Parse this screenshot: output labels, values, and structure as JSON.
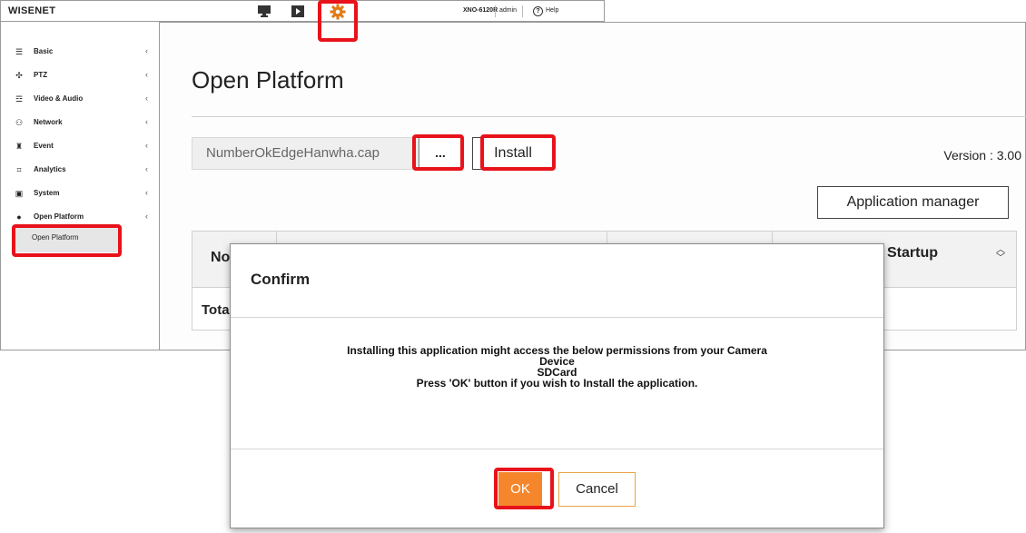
{
  "app": {
    "logo": "WISENET",
    "model": "XNO-6120R",
    "user": "admin",
    "help_label": "Help"
  },
  "topbar_icons": [
    "monitor-icon",
    "play-icon",
    "gear-icon"
  ],
  "sidebar": {
    "items": [
      {
        "label": "Basic",
        "icon": "list-icon"
      },
      {
        "label": "PTZ",
        "icon": "ptz-icon"
      },
      {
        "label": "Video & Audio",
        "icon": "video-audio-icon"
      },
      {
        "label": "Network",
        "icon": "network-icon"
      },
      {
        "label": "Event",
        "icon": "event-icon"
      },
      {
        "label": "Analytics",
        "icon": "analytics-icon"
      },
      {
        "label": "System",
        "icon": "system-icon"
      },
      {
        "label": "Open Platform",
        "icon": "open-platform-icon"
      }
    ],
    "sub_item": "Open Platform"
  },
  "main": {
    "title": "Open Platform",
    "file_value": "NumberOkEdgeHanwha.cap",
    "browse_label": "...",
    "install_label": "Install",
    "version": "Version : 3.00",
    "app_manager_label": "Application manager",
    "table": {
      "col_no": "No",
      "col_setup": "Startup",
      "total_label": "Total"
    }
  },
  "modal": {
    "title": "Confirm",
    "body_lines": [
      "Installing this application might access the below permissions from your Camera",
      "Device",
      "SDCard",
      "Press 'OK' button if you wish to Install the application."
    ],
    "ok_label": "OK",
    "cancel_label": "Cancel"
  },
  "colors": {
    "highlight": "#e8121a",
    "ok_button": "#f5862b",
    "cancel_border": "#e8a341"
  }
}
